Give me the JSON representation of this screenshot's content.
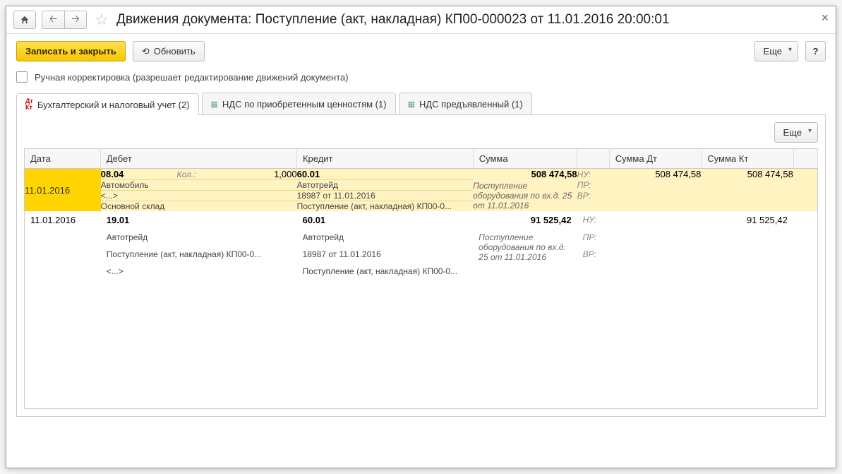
{
  "title": "Движения документа: Поступление (акт, накладная) КП00-000023 от 11.01.2016 20:00:01",
  "toolbar": {
    "save_close": "Записать и закрыть",
    "refresh": "Обновить",
    "more": "Еще",
    "help": "?"
  },
  "manual_edit_label": "Ручная корректировка (разрешает редактирование движений документа)",
  "tabs": [
    {
      "label": "Бухгалтерский и налоговый учет (2)"
    },
    {
      "label": "НДС по приобретенным ценностям (1)"
    },
    {
      "label": "НДС предъявленный (1)"
    }
  ],
  "grid": {
    "more": "Еще",
    "headers": {
      "date": "Дата",
      "debit": "Дебет",
      "credit": "Кредит",
      "sum": "Сумма",
      "sum_dt": "Сумма Дт",
      "sum_kt": "Сумма Кт"
    },
    "row_labels": {
      "qty": "Кол.:",
      "nu": "НУ:",
      "pr": "ПР:",
      "vr": "ВР:"
    },
    "rows": [
      {
        "highlight": true,
        "date": "11.01.2016",
        "debit_acct": "08.04",
        "qty": "1,000",
        "debit_sub1": "Автомобиль",
        "debit_sub2": "<...>",
        "debit_sub3": "Основной склад",
        "credit_acct": "60.01",
        "credit_sub1": "Автотрейд",
        "credit_sub2": "18987 от 11.01.2016",
        "credit_sub3": "Поступление (акт, накладная) КП00-0...",
        "sum": "508 474,58",
        "sum_desc": "Поступление оборудования по вх.д. 25 от 11.01.2016",
        "sum_dt": "508 474,58",
        "sum_kt": "508 474,58"
      },
      {
        "highlight": false,
        "date": "11.01.2016",
        "debit_acct": "19.01",
        "qty": "",
        "debit_sub1": "Автотрейд",
        "debit_sub2": "Поступление (акт, накладная) КП00-0...",
        "debit_sub3": "<...>",
        "credit_acct": "60.01",
        "credit_sub1": "Автотрейд",
        "credit_sub2": "18987 от 11.01.2016",
        "credit_sub3": "Поступление (акт, накладная) КП00-0...",
        "sum": "91 525,42",
        "sum_desc": "Поступление оборудования по вх.д. 25 от 11.01.2016",
        "sum_dt": "",
        "sum_kt": "91 525,42"
      }
    ]
  }
}
